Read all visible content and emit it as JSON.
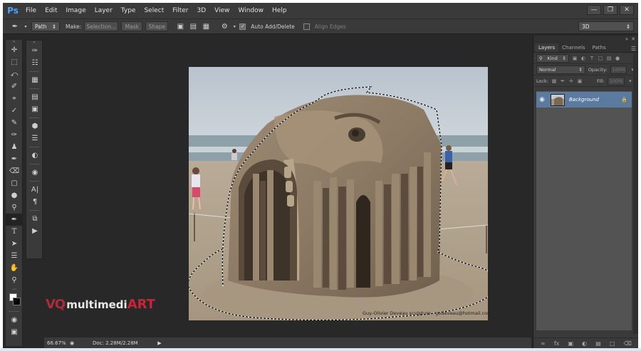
{
  "app": {
    "logo": "Ps"
  },
  "menu": [
    "File",
    "Edit",
    "Image",
    "Layer",
    "Type",
    "Select",
    "Filter",
    "3D",
    "View",
    "Window",
    "Help"
  ],
  "window_buttons": [
    "minimize-icon",
    "restore-icon",
    "close-icon"
  ],
  "options": {
    "tool_icon": "pen-icon",
    "mode_value": "Path",
    "make_label": "Make:",
    "selection_label": "Selection...",
    "mask_label": "Mask",
    "shape_label": "Shape",
    "auto_add_delete_label": "Auto Add/Delete",
    "auto_add_delete_checked": true,
    "align_edges_label": "Align Edges",
    "align_edges_checked": false,
    "workspace_value": "3D"
  },
  "tools_col1": [
    "move-icon",
    "marquee-icon",
    "lasso-icon",
    "quick-select-icon",
    "crop-icon",
    "eyedropper-icon",
    "healing-brush-icon",
    "brush-icon",
    "clone-stamp-icon",
    "history-brush-icon",
    "eraser-icon",
    "gradient-icon",
    "blur-icon",
    "dodge-icon",
    "pen-icon",
    "type-icon",
    "path-select-icon",
    "shape-icon",
    "hand-icon",
    "zoom-icon"
  ],
  "tools_col2": [
    "brush-preset-icon",
    "character-icon",
    "swatches-icon",
    "histogram-icon",
    "info-icon",
    "3d-icon",
    "adjust-icon",
    "circle-icon",
    "paths-icon",
    "type-panel-icon",
    "paragraph-icon",
    "layer-comps-icon",
    "play-icon"
  ],
  "status": {
    "zoom": "66.67%",
    "doc": "Doc: 2.28M/2.28M"
  },
  "layers_panel": {
    "tabs": [
      "Layers",
      "Channels",
      "Paths"
    ],
    "active_tab": "Layers",
    "filter_kind": "Kind",
    "blend_mode": "Normal",
    "opacity_label": "Opacity:",
    "opacity_value": "100%",
    "lock_label": "Lock:",
    "fill_label": "Fill:",
    "fill_value": "100%",
    "layers": [
      {
        "name": "Background",
        "visible": true,
        "locked": true
      }
    ]
  },
  "canvas": {
    "credit": "Guy-Olivier Deveau sculpture - godeveau@hotmail.com"
  },
  "watermark": {
    "part1": "VQ",
    "part2": "multimedi",
    "part3": "ART"
  }
}
